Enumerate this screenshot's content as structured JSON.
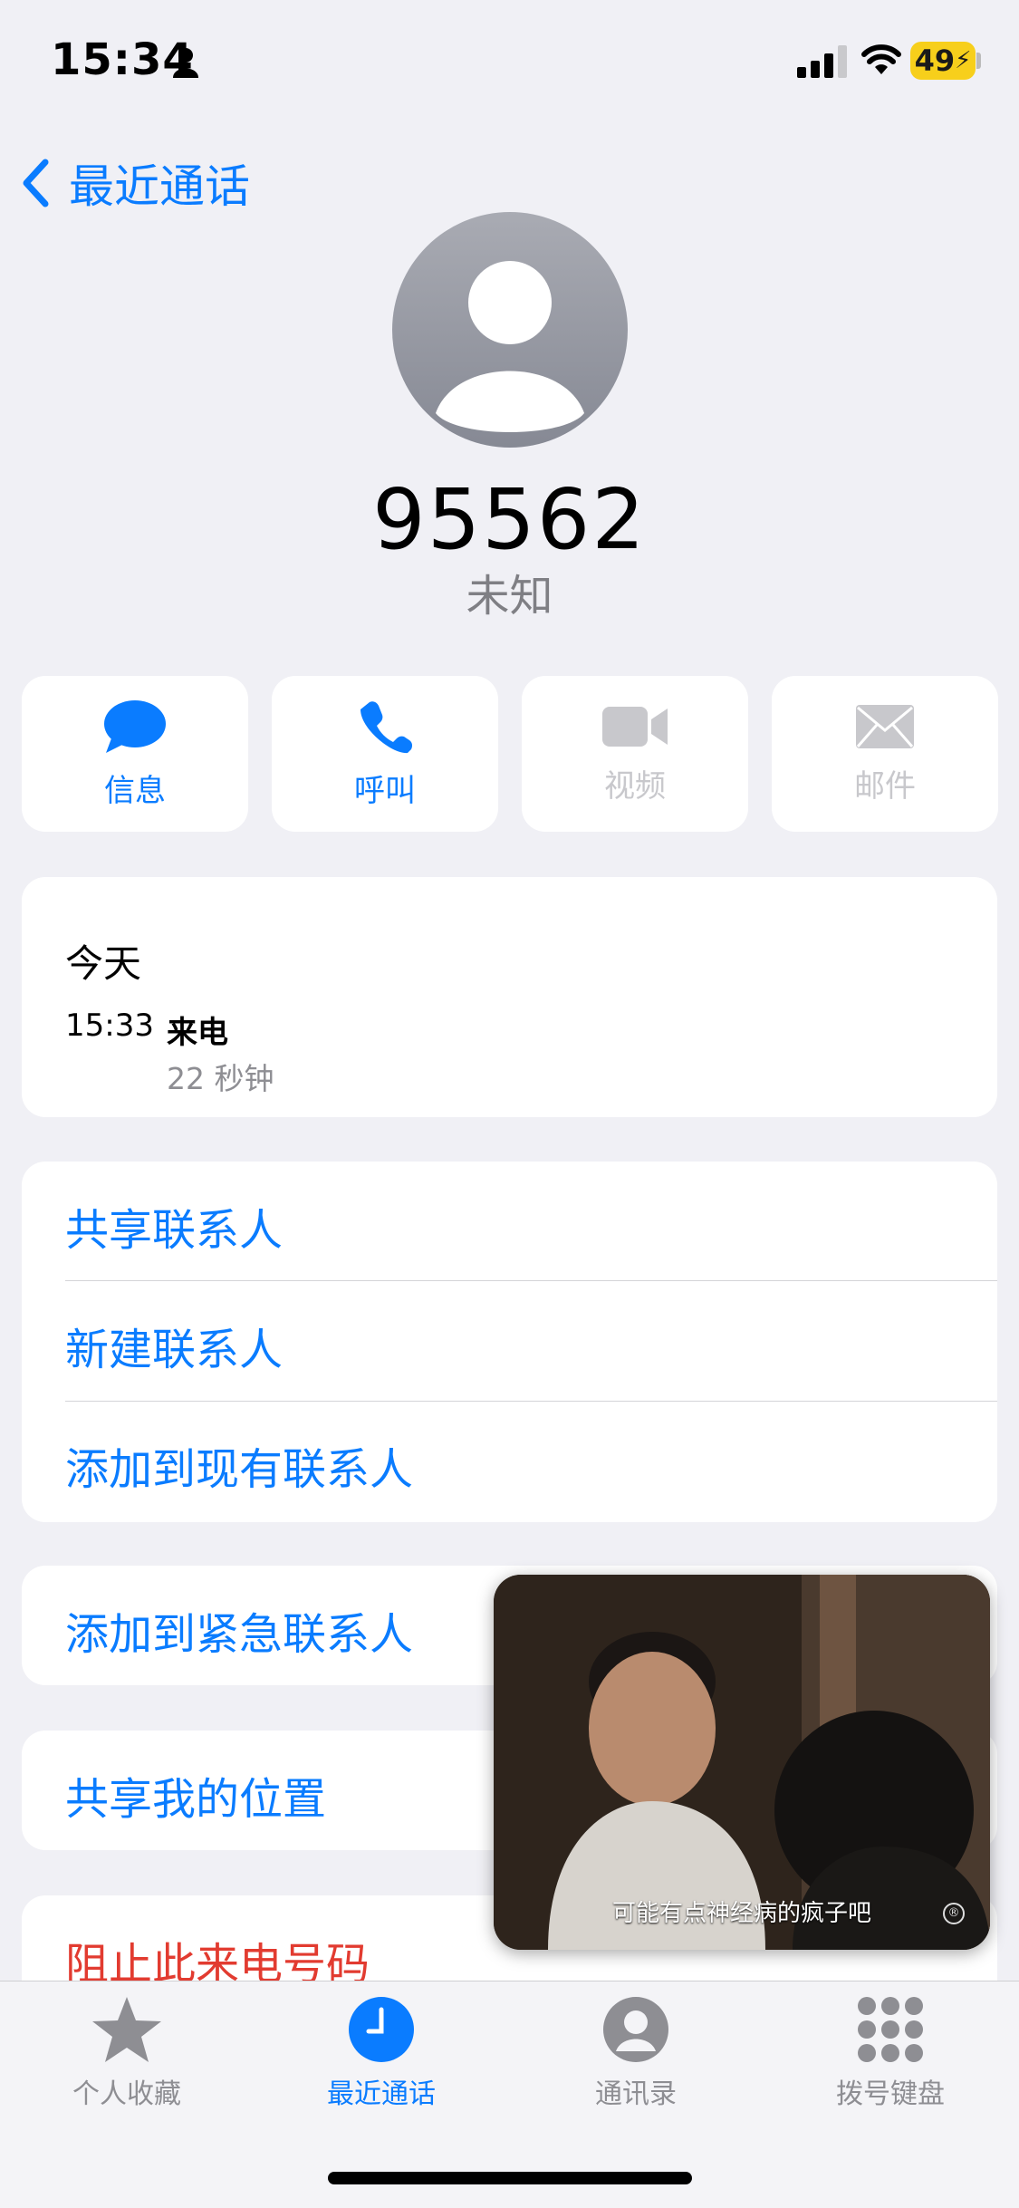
{
  "status_bar": {
    "time": "15:34",
    "battery": "49"
  },
  "nav": {
    "back_label": "最近通话"
  },
  "contact": {
    "number": "95562",
    "subtitle": "未知"
  },
  "actions": [
    {
      "label": "信息",
      "icon": "message-icon",
      "enabled": true
    },
    {
      "label": "呼叫",
      "icon": "phone-icon",
      "enabled": true
    },
    {
      "label": "视频",
      "icon": "video-icon",
      "enabled": false
    },
    {
      "label": "邮件",
      "icon": "mail-icon",
      "enabled": false
    }
  ],
  "history": {
    "day": "今天",
    "time": "15:33",
    "type": "来电",
    "duration": "22 秒钟"
  },
  "options": {
    "share_contact": "共享联系人",
    "new_contact": "新建联系人",
    "add_existing": "添加到现有联系人",
    "add_emergency": "添加到紧急联系人",
    "share_location": "共享我的位置",
    "block_caller": "阻止此来电号码"
  },
  "pip": {
    "caption": "可能有点神经病的疯子吧",
    "mark": "®"
  },
  "tabbar": [
    {
      "label": "个人收藏",
      "icon": "star-icon",
      "active": false
    },
    {
      "label": "最近通话",
      "icon": "clock-icon",
      "active": true
    },
    {
      "label": "通讯录",
      "icon": "person-circle-icon",
      "active": false
    },
    {
      "label": "拨号键盘",
      "icon": "keypad-icon",
      "active": false
    }
  ],
  "colors": {
    "accent": "#0a7cff",
    "destructive": "#e23b30",
    "disabled": "#c8c8cc",
    "background": "#f0f0f5"
  }
}
